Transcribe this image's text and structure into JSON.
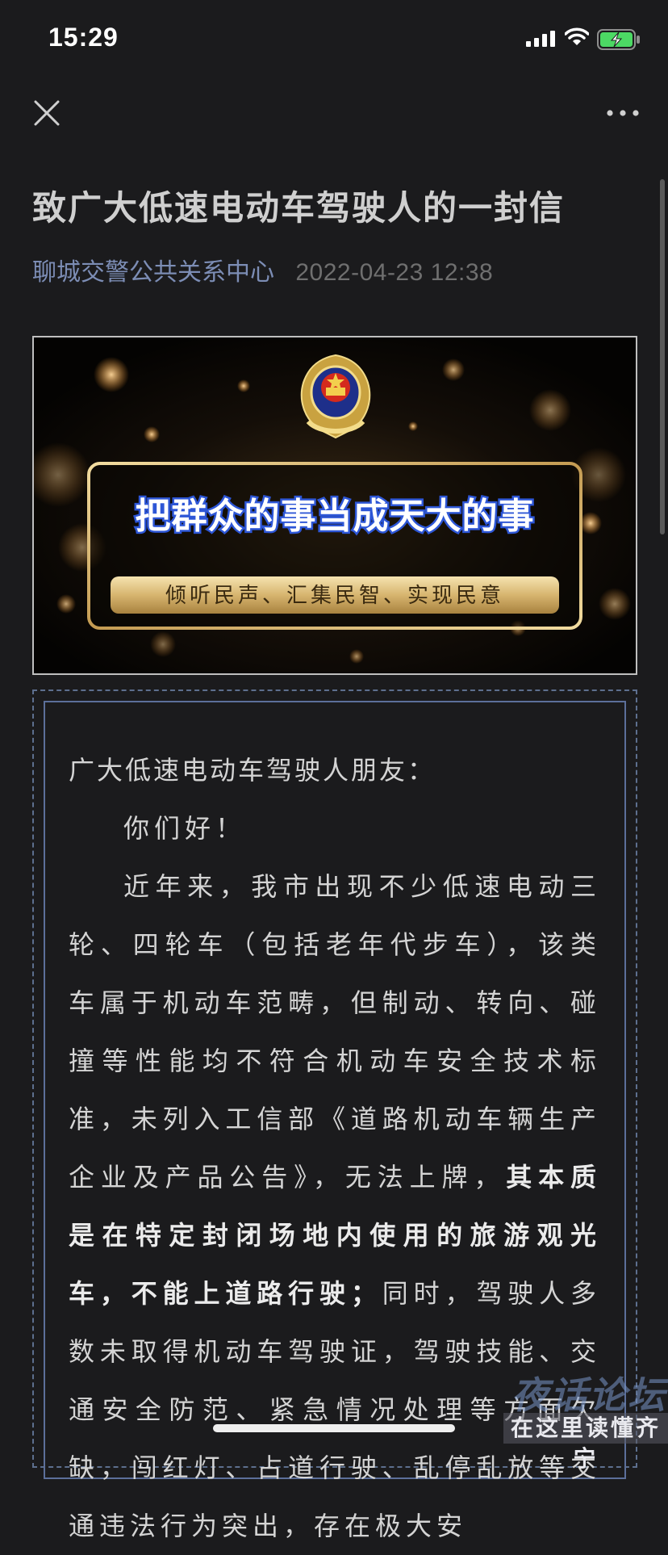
{
  "status_bar": {
    "time": "15:29"
  },
  "article": {
    "title": "致广大低速电动车驾驶人的一封信",
    "author": "聊城交警公共关系中心",
    "date": "2022-04-23 12:38"
  },
  "banner": {
    "headline": "把群众的事当成天大的事",
    "slogan": "倾听民声、汇集民智、实现民意"
  },
  "letter": {
    "salutation": "广大低速电动车驾驶人朋友：",
    "greeting": "你们好！",
    "p1_a": "近年来，我市出现不少低速电动三轮、四轮车（包括老年代步车），该类车属于机动车范畴，但制动、转向、碰撞等性能均不符合机动车安全技术标准，未列入工信部《道路机动车辆生产企业及产品公告》，无法上牌，",
    "p1_bold": "其本质是在特定封闭场地内使用的旅游观光车，不能上道路行驶；",
    "p1_b": "同时，驾驶人多数未取得机动车驾驶证，驾驶技能、交通安全防范、紧急情况处理等方面欠缺，闯红灯、占道行驶、乱停乱放等交通违法行为突出，存在极大安"
  },
  "watermark": {
    "top": "夜话论坛",
    "bottom": "在这里读懂齐宁"
  }
}
